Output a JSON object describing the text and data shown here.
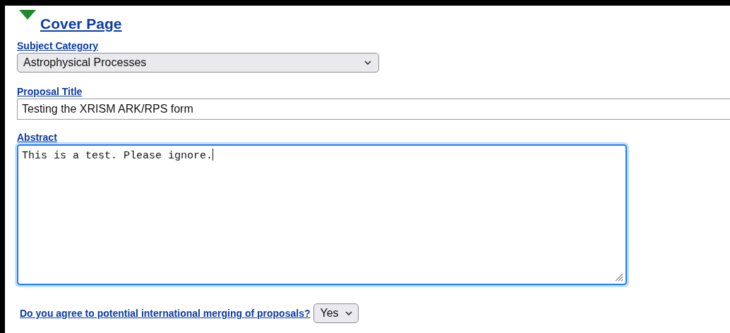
{
  "section": {
    "title": "Cover Page",
    "expanded": true
  },
  "fields": [
    {
      "kind": "select",
      "label": "Subject Category",
      "value": "Astrophysical Processes"
    },
    {
      "kind": "text",
      "label": "Proposal Title",
      "value": "Testing the XRISM ARK/RPS form"
    },
    {
      "kind": "textarea",
      "label": "Abstract",
      "value": "This is a test. Please ignore.",
      "focused": true
    }
  ],
  "question": {
    "label": "Do you agree to potential international merging of proposals?",
    "value": "Yes"
  }
}
